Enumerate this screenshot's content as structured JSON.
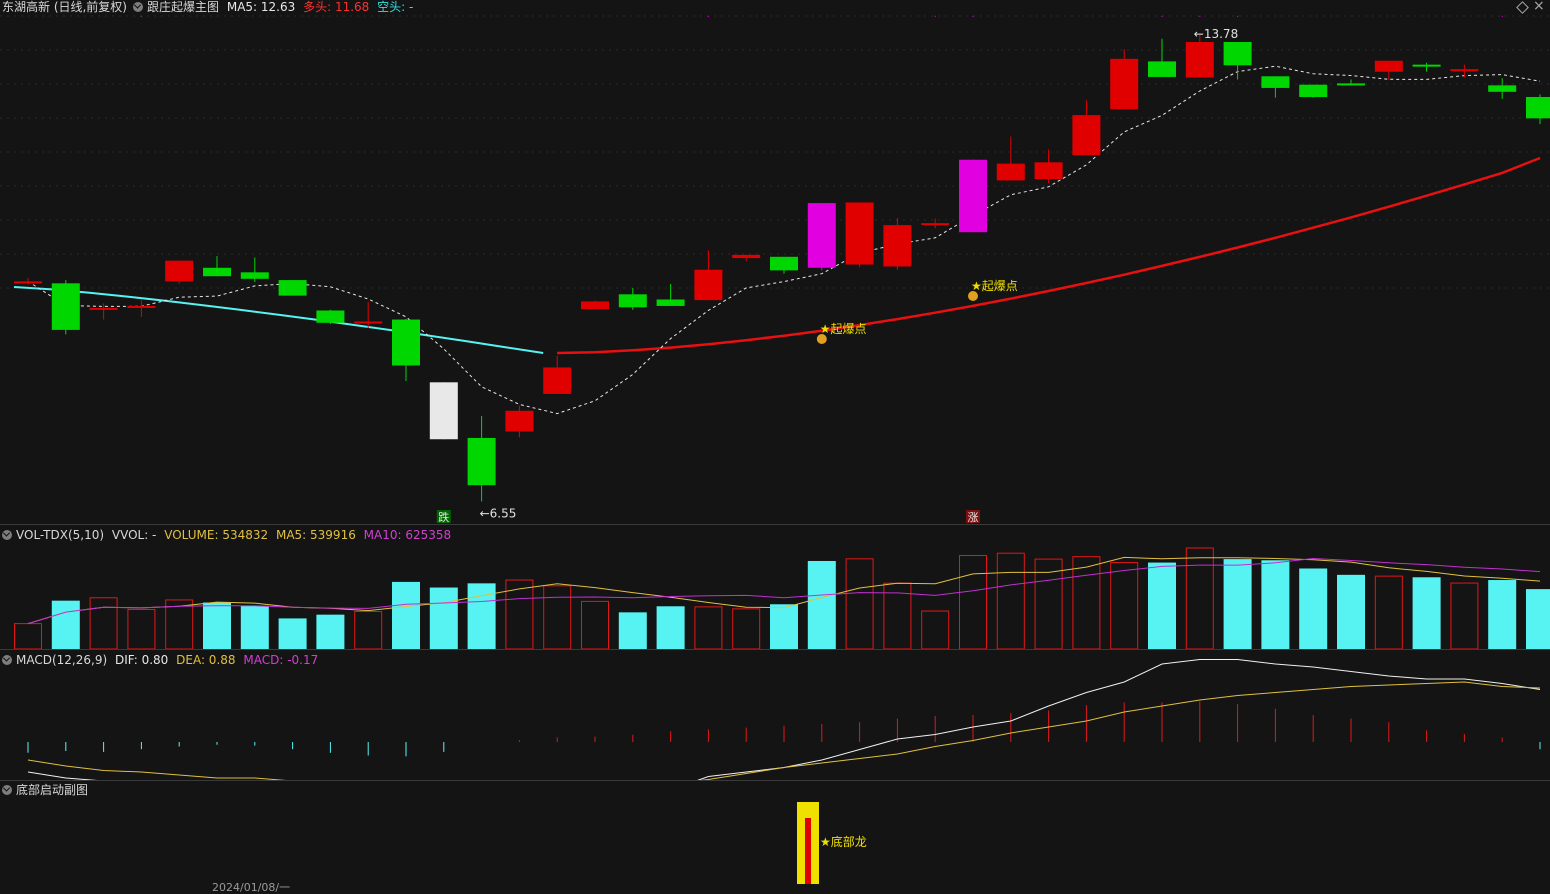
{
  "main": {
    "stock_name": "东湖高新 (日线,前复权)",
    "indicator": "跟庄起爆主图",
    "ma5": "MA5: 12.63",
    "duotou": "多头: 11.68",
    "kongtou": "空头: -",
    "high_label": "13.78",
    "low_label": "6.55",
    "explode_label": "起爆点",
    "die_label": "跌",
    "zhang_label": "涨"
  },
  "vol": {
    "title": "VOL-TDX(5,10)",
    "vvol": "VVOL: -",
    "volume": "VOLUME: 534832",
    "ma5": "MA5: 539916",
    "ma10": "MA10: 625358"
  },
  "macd": {
    "title": "MACD(12,26,9)",
    "dif": "DIF: 0.80",
    "dea": "DEA: 0.88",
    "macd": "MACD: -0.17"
  },
  "sub": {
    "title": "底部启动副图",
    "label": "★底部龙"
  },
  "bottom_date": "2024/01/08/一",
  "colors": {
    "up": "#e00000",
    "down": "#00d600",
    "cyan": "#57f3f3",
    "magenta": "#e000e0",
    "yellow": "#f0e000",
    "white": "#e8e8e8"
  },
  "chart_data": {
    "type": "candlestick",
    "candles": [
      [
        9.96,
        9.96,
        10.01,
        9.91
      ],
      [
        9.93,
        9.21,
        9.98,
        9.14
      ],
      [
        9.55,
        9.55,
        9.62,
        9.37
      ],
      [
        9.58,
        9.58,
        9.67,
        9.41
      ],
      [
        9.96,
        10.28,
        10.28,
        9.92
      ],
      [
        10.17,
        10.04,
        10.35,
        10.04
      ],
      [
        10.1,
        10.0,
        10.33,
        9.95
      ],
      [
        9.98,
        9.74,
        9.98,
        9.74
      ],
      [
        9.51,
        9.32,
        9.52,
        9.3
      ],
      [
        9.34,
        9.34,
        9.64,
        9.24
      ],
      [
        9.37,
        8.66,
        9.38,
        8.42
      ],
      [
        8.4,
        7.52,
        8.4,
        7.52
      ],
      [
        7.54,
        6.81,
        7.88,
        6.56
      ],
      [
        7.64,
        7.96,
        8.04,
        7.55
      ],
      [
        8.22,
        8.63,
        8.81,
        8.48
      ],
      [
        9.53,
        9.65,
        9.66,
        9.53
      ],
      [
        9.76,
        9.56,
        9.86,
        9.52
      ],
      [
        9.68,
        9.58,
        9.92,
        9.58
      ],
      [
        9.67,
        10.14,
        10.44,
        9.67
      ],
      [
        10.32,
        10.37,
        10.37,
        10.27
      ],
      [
        10.34,
        10.13,
        10.34,
        10.08
      ],
      [
        11.17,
        10.17,
        11.17,
        10.13
      ],
      [
        10.22,
        11.18,
        11.18,
        10.18
      ],
      [
        10.19,
        10.83,
        10.94,
        10.14
      ],
      [
        10.86,
        10.86,
        10.93,
        10.78
      ],
      [
        10.72,
        11.84,
        11.84,
        10.72
      ],
      [
        11.52,
        11.78,
        12.2,
        11.52
      ],
      [
        11.54,
        11.8,
        12.0,
        11.48
      ],
      [
        11.91,
        12.53,
        12.76,
        11.91
      ],
      [
        12.62,
        13.4,
        13.55,
        12.62
      ],
      [
        13.36,
        13.12,
        13.71,
        13.12
      ],
      [
        13.11,
        13.66,
        13.78,
        13.11
      ],
      [
        13.66,
        13.3,
        13.66,
        13.08
      ],
      [
        13.13,
        12.95,
        13.13,
        12.8
      ],
      [
        13.0,
        12.81,
        13.0,
        12.8
      ],
      [
        13.02,
        12.99,
        13.08,
        12.99
      ],
      [
        13.2,
        13.37,
        13.37,
        13.07
      ],
      [
        13.31,
        13.29,
        13.34,
        13.2
      ],
      [
        13.24,
        13.24,
        13.31,
        13.11
      ],
      [
        12.99,
        12.89,
        13.1,
        12.78
      ],
      [
        12.81,
        12.48,
        12.85,
        12.39
      ]
    ],
    "volume": [
      176000,
      335000,
      355000,
      274000,
      340000,
      322000,
      299000,
      212000,
      238000,
      260000,
      465000,
      426000,
      455000,
      478000,
      438000,
      330000,
      254000,
      296000,
      292000,
      278000,
      310000,
      610000,
      625000,
      456000,
      263000,
      648000,
      664000,
      623000,
      640000,
      599000,
      599000,
      700000,
      623000,
      615000,
      558000,
      514000,
      505000,
      497000,
      457000,
      478000,
      415000
    ],
    "macd_hist": [
      -0.12,
      -0.1,
      -0.11,
      -0.08,
      -0.05,
      -0.03,
      -0.04,
      -0.08,
      -0.12,
      -0.15,
      -0.16,
      -0.11,
      0.0,
      0.02,
      0.05,
      0.06,
      0.08,
      0.12,
      0.14,
      0.16,
      0.18,
      0.2,
      0.22,
      0.26,
      0.29,
      0.3,
      0.32,
      0.35,
      0.41,
      0.44,
      0.44,
      0.45,
      0.42,
      0.37,
      0.3,
      0.26,
      0.22,
      0.13,
      0.09,
      0.05,
      -0.08
    ],
    "dif": [
      -0.2,
      -0.24,
      -0.26,
      -0.27,
      -0.26,
      -0.27,
      -0.28,
      -0.3,
      -0.3,
      -0.33,
      -0.39,
      -0.47,
      -0.54,
      -0.55,
      -0.5,
      -0.42,
      -0.37,
      -0.32,
      -0.23,
      -0.2,
      -0.17,
      -0.12,
      -0.05,
      0.02,
      0.05,
      0.1,
      0.14,
      0.24,
      0.33,
      0.4,
      0.52,
      0.55,
      0.55,
      0.52,
      0.5,
      0.47,
      0.44,
      0.42,
      0.42,
      0.39,
      0.35
    ],
    "dea": [
      -0.12,
      -0.16,
      -0.19,
      -0.2,
      -0.22,
      -0.24,
      -0.24,
      -0.26,
      -0.28,
      -0.28,
      -0.32,
      -0.34,
      -0.37,
      -0.38,
      -0.36,
      -0.34,
      -0.32,
      -0.28,
      -0.25,
      -0.21,
      -0.17,
      -0.14,
      -0.11,
      -0.08,
      -0.03,
      0.01,
      0.06,
      0.1,
      0.14,
      0.2,
      0.24,
      0.28,
      0.31,
      0.33,
      0.35,
      0.37,
      0.38,
      0.39,
      0.4,
      0.37,
      0.36
    ]
  }
}
